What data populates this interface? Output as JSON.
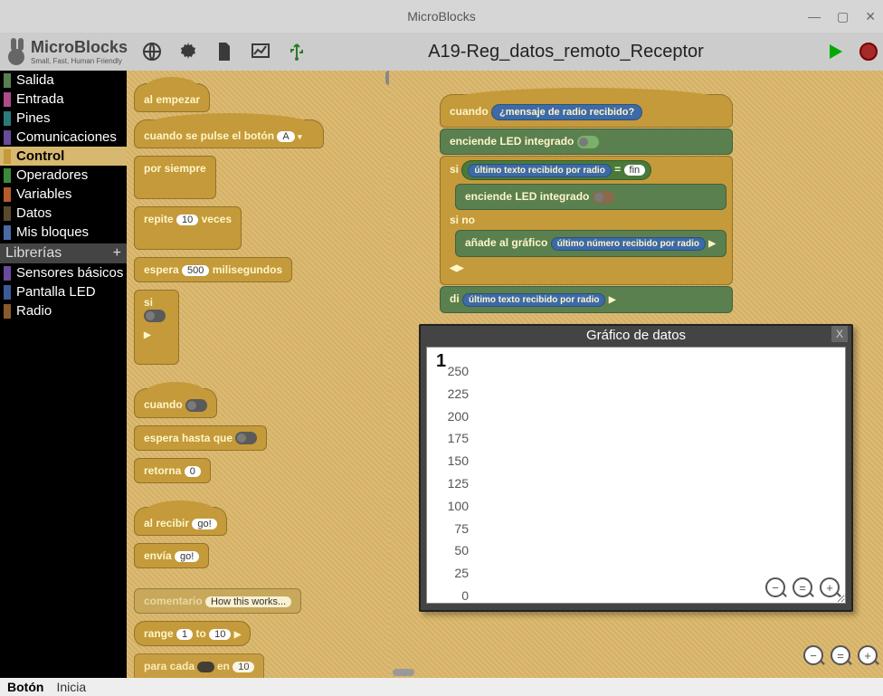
{
  "window": {
    "title": "MicroBlocks",
    "min": "—",
    "max": "▢",
    "close": "✕"
  },
  "logo": {
    "name": "MicroBlocks",
    "tagline": "Small, Fast, Human Friendly"
  },
  "document_title": "A19-Reg_datos_remoto_Receptor",
  "categories": [
    {
      "label": "Salida",
      "color": "#5a8050"
    },
    {
      "label": "Entrada",
      "color": "#b04a8a"
    },
    {
      "label": "Pines",
      "color": "#2a7a7a"
    },
    {
      "label": "Comunicaciones",
      "color": "#6a4a9a"
    },
    {
      "label": "Control",
      "color": "#c49a3a",
      "active": true
    },
    {
      "label": "Operadores",
      "color": "#3a8a3a"
    },
    {
      "label": "Variables",
      "color": "#b85a2a"
    },
    {
      "label": "Datos",
      "color": "#5a4a2a"
    },
    {
      "label": "Mis bloques",
      "color": "#4a6aa8"
    }
  ],
  "libraries_label": "Librerías",
  "libraries_plus": "+",
  "libraries": [
    {
      "label": "Sensores básicos",
      "color": "#6a4a9a"
    },
    {
      "label": "Pantalla LED",
      "color": "#3a5a9a"
    },
    {
      "label": "Radio",
      "color": "#8a5a2a"
    }
  ],
  "palette": {
    "al_empezar": "al empezar",
    "cuando_boton_pre": "cuando se pulse el botón",
    "cuando_boton_val": "A",
    "por_siempre": "por siempre",
    "repite_pre": "repite",
    "repite_val": "10",
    "repite_post": "veces",
    "espera_pre": "espera",
    "espera_val": "500",
    "espera_post": "milisegundos",
    "si": "si",
    "cuando": "cuando",
    "espera_hasta": "espera hasta que",
    "retorna": "retorna",
    "retorna_val": "0",
    "al_recibir": "al recibir",
    "al_recibir_val": "go!",
    "envia": "envía",
    "envia_val": "go!",
    "comentario": "comentario",
    "comentario_val": "How this works...",
    "range_pre": "range",
    "range_a": "1",
    "range_mid": "to",
    "range_b": "10",
    "for_each_pre": "para cada",
    "for_each_mid": "en",
    "for_each_val": "10"
  },
  "script": {
    "cuando": "cuando",
    "msg_recibido": "¿mensaje de radio recibido?",
    "led_on": "enciende LED integrado",
    "si": "si",
    "ult_texto": "último texto recibido por radio",
    "eq": "=",
    "fin": "fin",
    "led_on2": "enciende LED integrado",
    "si_no": "si no",
    "anade": "añade al gráfico",
    "ult_num": "último número recibido por radio",
    "di": "di",
    "ult_texto2": "último texto recibido por radio"
  },
  "chart_data": {
    "type": "line",
    "title": "Gráfico de datos",
    "close": "X",
    "x_current": "1",
    "ylim": [
      0,
      250
    ],
    "yticks": [
      250,
      225,
      200,
      175,
      150,
      125,
      100,
      75,
      50,
      25,
      0
    ],
    "series": [],
    "tools": {
      "zoom_out": "−",
      "reset": "=",
      "zoom_in": "+"
    }
  },
  "status": {
    "boton": "Botón",
    "inicia": "Inicia"
  }
}
